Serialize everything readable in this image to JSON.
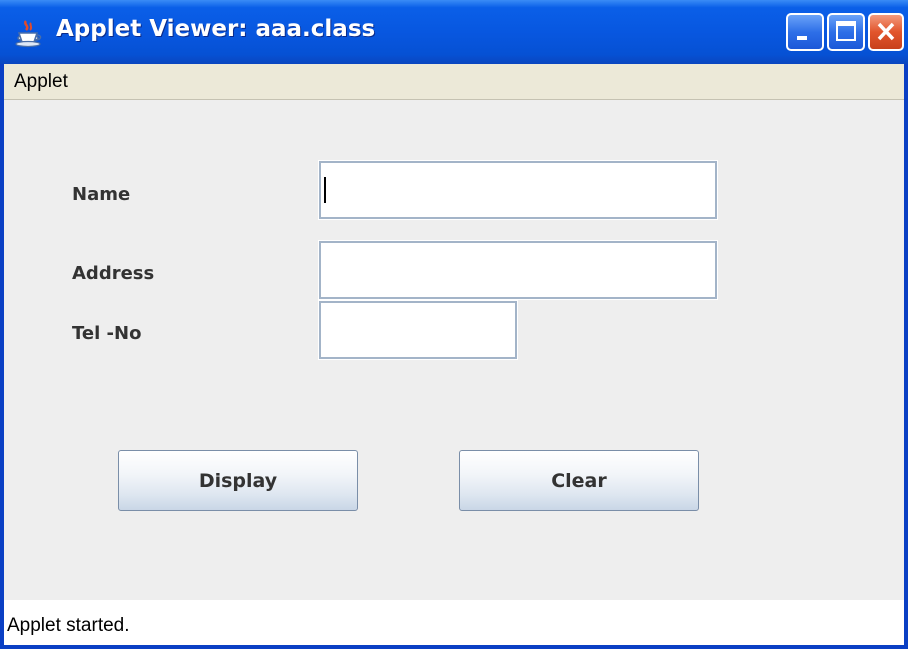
{
  "window": {
    "title": "Applet Viewer: aaa.class",
    "controls": [
      "minimize-icon",
      "maximize-icon",
      "close-icon"
    ]
  },
  "menubar": {
    "items": [
      {
        "label": "Applet"
      }
    ]
  },
  "form": {
    "fields": [
      {
        "label": "Name",
        "value": "",
        "focused": true
      },
      {
        "label": "Address",
        "value": ""
      },
      {
        "label": "Tel -No",
        "value": ""
      }
    ],
    "buttons": [
      {
        "label": "Display"
      },
      {
        "label": "Clear"
      }
    ]
  },
  "status": {
    "text": "Applet started."
  },
  "colors": {
    "titlebar": "#0857e0",
    "menubar": "#ece9d8",
    "panel": "#eeeeee",
    "close_button": "#e2552c"
  }
}
